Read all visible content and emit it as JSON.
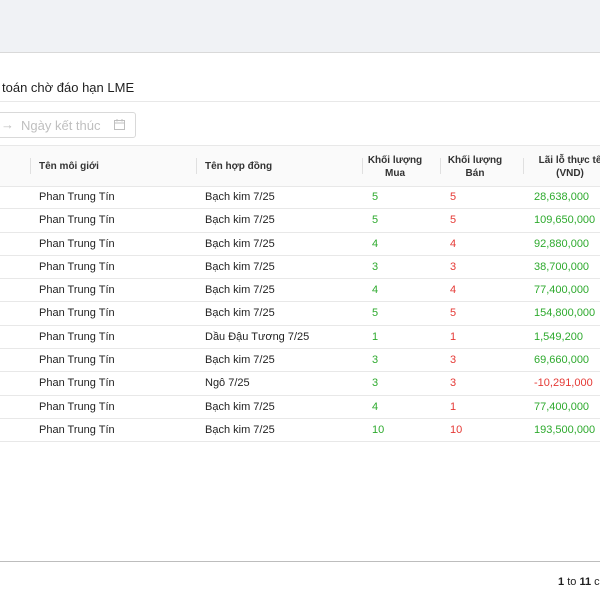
{
  "page": {
    "title": "toán chờ đáo hạn LME"
  },
  "filters": {
    "date_end_placeholder": "Ngày kết thúc",
    "arrow_icon": "arrow-right-icon",
    "calendar_icon": "calendar-icon"
  },
  "table": {
    "headers": {
      "broker": "Tên môi giới",
      "contract": "Tên hợp đồng",
      "buy_line1": "Khối lượng",
      "buy_line2": "Mua",
      "sell_line1": "Khối lượng",
      "sell_line2": "Bán",
      "pl_line1": "Lãi lỗ thực tế",
      "pl_line2": "(VND)"
    },
    "rows": [
      {
        "broker": "Phan Trung Tín",
        "contract": "Bạch kim 7/25",
        "buy": "5",
        "sell": "5",
        "pl": "28,638,000",
        "pl_sign": "pos"
      },
      {
        "broker": "Phan Trung Tín",
        "contract": "Bạch kim 7/25",
        "buy": "5",
        "sell": "5",
        "pl": "109,650,000",
        "pl_sign": "pos"
      },
      {
        "broker": "Phan Trung Tín",
        "contract": "Bạch kim 7/25",
        "buy": "4",
        "sell": "4",
        "pl": "92,880,000",
        "pl_sign": "pos"
      },
      {
        "broker": "Phan Trung Tín",
        "contract": "Bạch kim 7/25",
        "buy": "3",
        "sell": "3",
        "pl": "38,700,000",
        "pl_sign": "pos"
      },
      {
        "broker": "Phan Trung Tín",
        "contract": "Bạch kim 7/25",
        "buy": "4",
        "sell": "4",
        "pl": "77,400,000",
        "pl_sign": "pos"
      },
      {
        "broker": "Phan Trung Tín",
        "contract": "Bạch kim 7/25",
        "buy": "5",
        "sell": "5",
        "pl": "154,800,000",
        "pl_sign": "pos"
      },
      {
        "broker": "Phan Trung Tín",
        "contract": "Dầu Đậu Tương 7/25",
        "buy": "1",
        "sell": "1",
        "pl": "1,549,200",
        "pl_sign": "pos"
      },
      {
        "broker": "Phan Trung Tín",
        "contract": "Bạch kim 7/25",
        "buy": "3",
        "sell": "3",
        "pl": "69,660,000",
        "pl_sign": "pos"
      },
      {
        "broker": "Phan Trung Tín",
        "contract": "Ngô 7/25",
        "buy": "3",
        "sell": "3",
        "pl": "-10,291,000",
        "pl_sign": "neg"
      },
      {
        "broker": "Phan Trung Tín",
        "contract": "Bạch kim 7/25",
        "buy": "4",
        "sell": "1",
        "pl": "77,400,000",
        "pl_sign": "pos"
      },
      {
        "broker": "Phan Trung Tín",
        "contract": "Bạch kim 7/25",
        "buy": "10",
        "sell": "10",
        "pl": "193,500,000",
        "pl_sign": "pos"
      }
    ]
  },
  "pagination": {
    "from": "1",
    "to_word": "to",
    "to": "11",
    "trailing": "c"
  },
  "colors": {
    "positive": "#2eaa2e",
    "negative": "#e53935"
  }
}
